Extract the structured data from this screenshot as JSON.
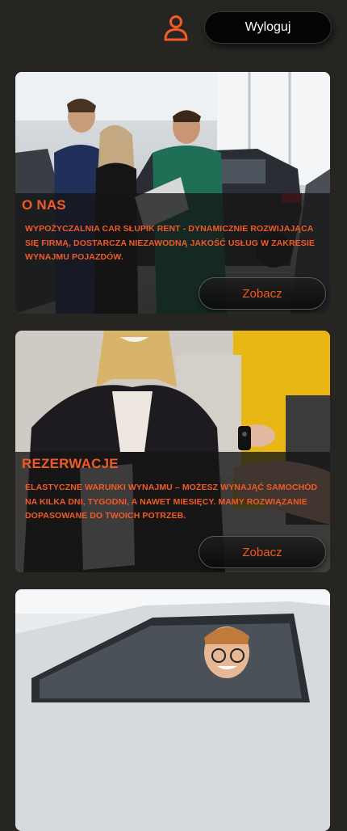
{
  "header": {
    "logout_label": "Wyloguj",
    "user_icon": "user-icon",
    "accent_color": "#f25a26"
  },
  "cards": [
    {
      "title": "O NAS",
      "description": "WYPOŻYCZALNIA CAR SŁUPIK RENT - DYNAMICZNIE ROZWIJAJĄCA SIĘ FIRMĄ, DOSTARCZA NIEZAWODNĄ JAKOŚĆ USŁUG W ZAKRESIE WYNAJMU POJAZDÓW.",
      "button_label": "Zobacz"
    },
    {
      "title": "REZERWACJE",
      "description": "ELASTYCZNE WARUNKI WYNAJMU – MOŻESZ WYNAJĄĆ SAMOCHÓD NA KILKA DNI, TYGODNI, A NAWET MIESIĘCY. MAMY ROZWIĄZANIE DOPASOWANE DO TWOICH POTRZEB.",
      "button_label": "Zobacz"
    }
  ]
}
